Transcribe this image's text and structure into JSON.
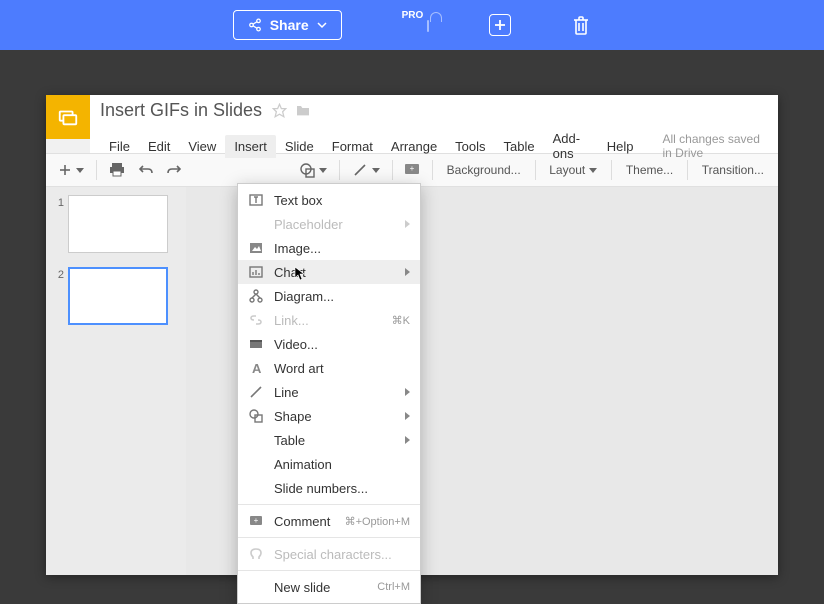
{
  "topbar": {
    "share": "Share",
    "pro": "PRO"
  },
  "doc": {
    "title": "Insert GIFs in Slides",
    "save_state": "All changes saved in Drive"
  },
  "menu": {
    "file": "File",
    "edit": "Edit",
    "view": "View",
    "insert": "Insert",
    "slide": "Slide",
    "format": "Format",
    "arrange": "Arrange",
    "tools": "Tools",
    "table": "Table",
    "addons": "Add-ons",
    "help": "Help"
  },
  "toolbar": {
    "background": "Background...",
    "layout": "Layout",
    "theme": "Theme...",
    "transition": "Transition..."
  },
  "thumbs": {
    "n1": "1",
    "n2": "2"
  },
  "dropdown": {
    "textbox": "Text box",
    "placeholder": "Placeholder",
    "image": "Image...",
    "chart": "Chart",
    "diagram": "Diagram...",
    "link": "Link...",
    "link_short": "⌘K",
    "video": "Video...",
    "wordart": "Word art",
    "line": "Line",
    "shape": "Shape",
    "table": "Table",
    "animation": "Animation",
    "slidenumbers": "Slide numbers...",
    "comment": "Comment",
    "comment_short": "⌘+Option+M",
    "special": "Special characters...",
    "newslide": "New slide",
    "newslide_short": "Ctrl+M"
  }
}
